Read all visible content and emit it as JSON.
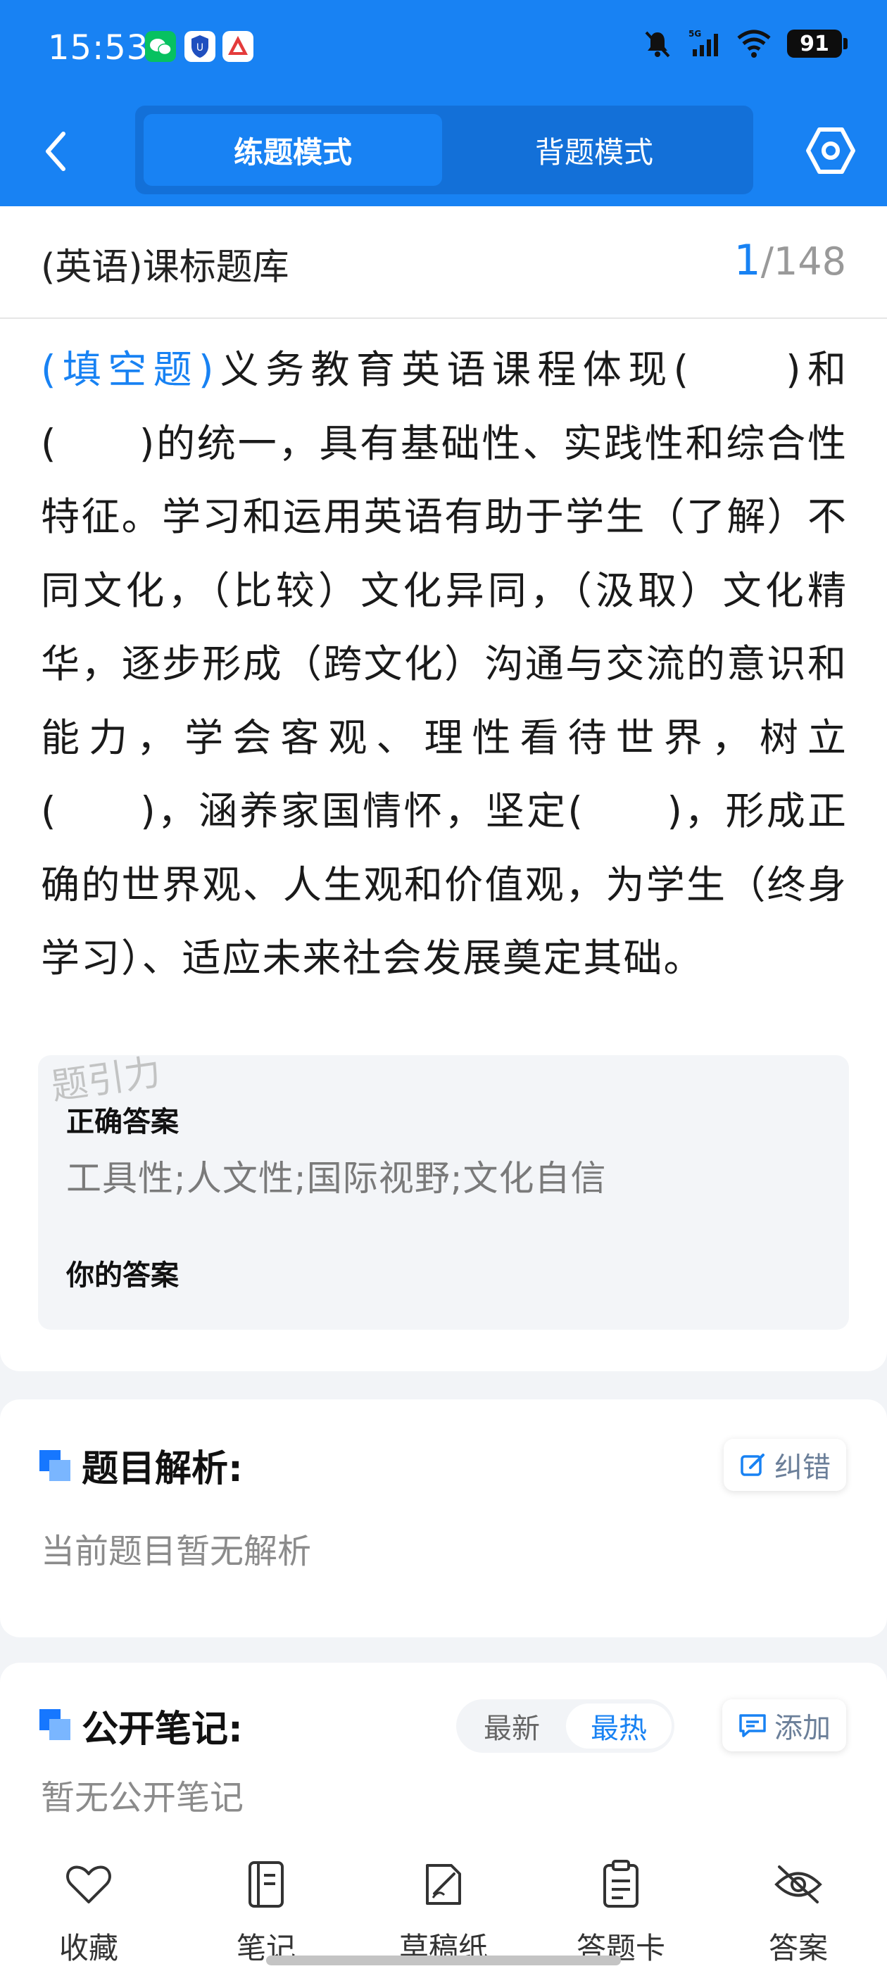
{
  "status_bar": {
    "time": "15:53",
    "battery": "91",
    "network": "5G"
  },
  "nav": {
    "mode_practice": "练题模式",
    "mode_memorize": "背题模式"
  },
  "question": {
    "bank_name": "(英语)课标题库",
    "current": "1",
    "total": "/148",
    "type_label": "(填空题)",
    "text": "义务教育英语课程体现(　　)和(　　)的统一，具有基础性、实践性和综合性特征。学习和运用英语有助于学生（了解）不同文化，（比较）文化异同，（汲取）文化精华，逐步形成（跨文化）沟通与交流的意识和能力，学会客观、理性看待世界，树立(　　)，涵养家国情怀，坚定(　　)，形成正确的世界观、人生观和价值观，为学生（终身学习）、适应未来社会发展奠定其础。"
  },
  "answers": {
    "watermark": "题引力",
    "correct_label": "正确答案",
    "correct_value": "工具性;人文性;国际视野;文化自信",
    "your_label": "你的答案"
  },
  "analysis": {
    "title": "题目解析:",
    "report_label": "纠错",
    "empty_text": "当前题目暂无解析"
  },
  "notes": {
    "title": "公开笔记:",
    "sort_new": "最新",
    "sort_hot": "最热",
    "add_label": "添加",
    "empty_text": "暂无公开笔记"
  },
  "bottom_bar": {
    "favorite": "收藏",
    "notes": "笔记",
    "scratch": "草稿纸",
    "answer_sheet": "答题卡",
    "answer": "答案"
  },
  "colors": {
    "primary": "#1882f3",
    "primary_dark": "#1370d8",
    "answer_bg": "#f3f5f8"
  }
}
